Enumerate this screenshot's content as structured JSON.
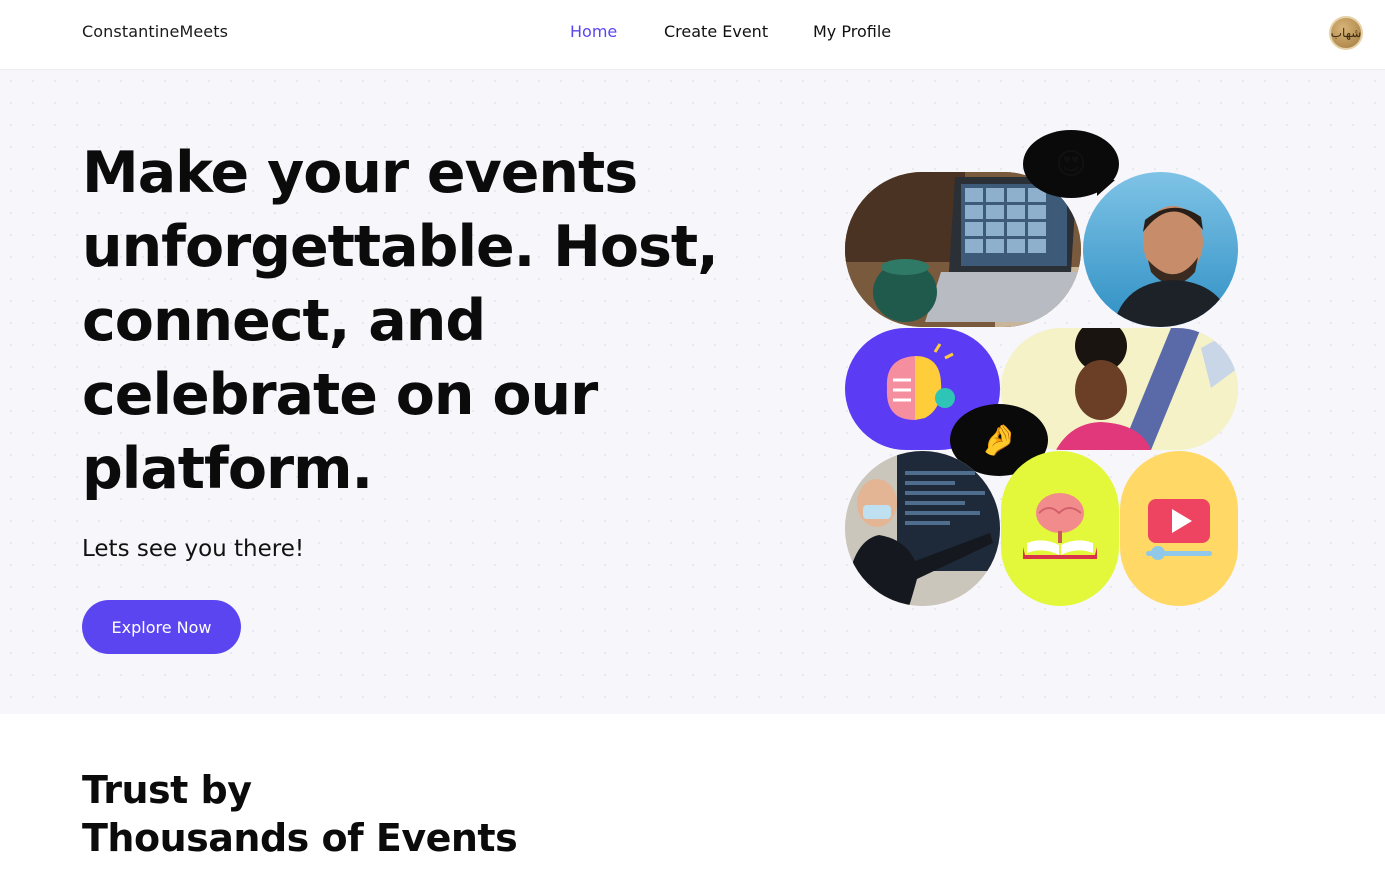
{
  "header": {
    "brand": "ConstantineMeets",
    "nav": [
      {
        "label": "Home"
      },
      {
        "label": "Create Event"
      },
      {
        "label": "My Profile"
      }
    ],
    "avatar_text": "شهاب"
  },
  "hero": {
    "title": "Make your events unforgettable. Host, connect, and celebrate on our platform.",
    "subtitle": "Lets see you there!",
    "cta_label": "Explore Now"
  },
  "collage": {
    "emoji_1": "😍",
    "emoji_2": "🤌"
  },
  "trust": {
    "line1": "Trust by",
    "line2": "Thousands of Events"
  },
  "colors": {
    "accent": "#5b45f0",
    "nav_active": "#5a46f0",
    "hero_bg": "#f6f6fb",
    "tile_purple": "#5b3cf4",
    "tile_lime": "#e3f83a",
    "tile_yellow": "#ffd866"
  }
}
